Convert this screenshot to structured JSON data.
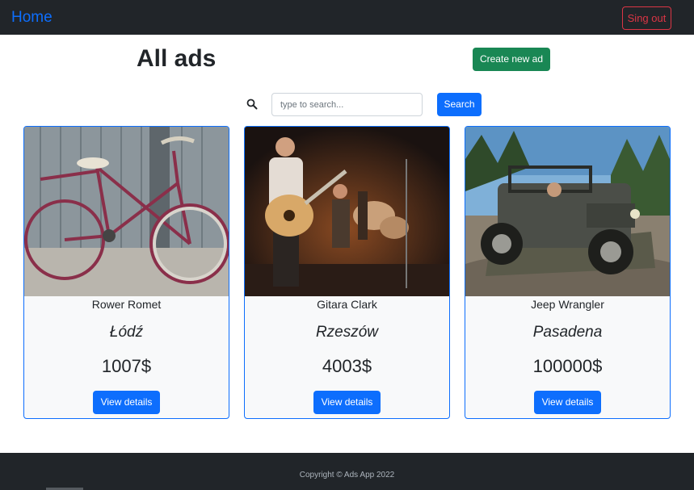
{
  "navbar": {
    "home_label": "Home",
    "signout_label": "Sing out"
  },
  "header": {
    "title": "All ads",
    "create_label": "Create new ad"
  },
  "search": {
    "icon": "search-icon",
    "placeholder": "type to search...",
    "value": "",
    "button_label": "Search"
  },
  "ads": [
    {
      "title": "Rower Romet",
      "location": "Łódź",
      "price": "1007$",
      "details_label": "View details",
      "image": "bicycle-photo"
    },
    {
      "title": "Gitara Clark",
      "location": "Rzeszów",
      "price": "4003$",
      "details_label": "View details",
      "image": "concert-photo"
    },
    {
      "title": "Jeep Wrangler",
      "location": "Pasadena",
      "price": "100000$",
      "details_label": "View details",
      "image": "jeep-photo"
    }
  ],
  "footer": {
    "text": "Copyright © Ads App 2022"
  },
  "colors": {
    "primary": "#0d6efd",
    "success": "#198754",
    "danger": "#dc3545",
    "dark": "#212529"
  }
}
